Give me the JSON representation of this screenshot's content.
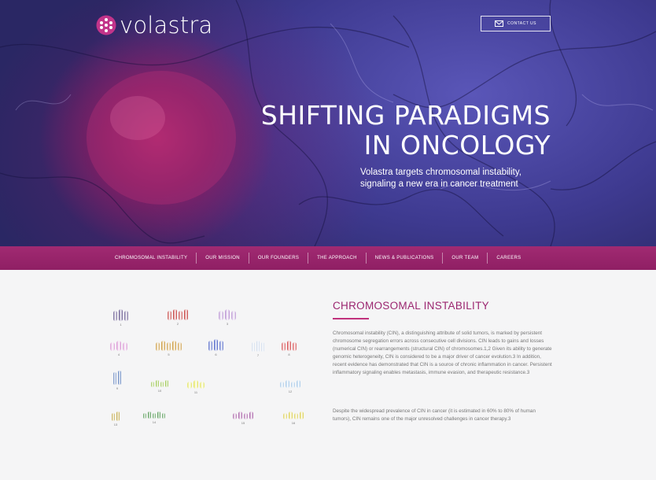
{
  "brand": {
    "name": "volastra",
    "colors": {
      "magenta": "#9b2670",
      "nav": "#9a2570",
      "hero_blue": "#4a46a0"
    }
  },
  "header": {
    "contact_label": "CONTACT US",
    "contact_icon": "mail-icon"
  },
  "hero": {
    "headline_line1": "SHIFTING PARADIGMS",
    "headline_line2": "IN ONCOLOGY",
    "subhead": "Volastra targets chromosomal instability, signaling a new era in cancer treatment"
  },
  "nav": {
    "items": [
      {
        "label": "CHROMOSOMAL INSTABILITY"
      },
      {
        "label": "OUR MISSION"
      },
      {
        "label": "OUR FOUNDERS"
      },
      {
        "label": "THE APPROACH"
      },
      {
        "label": "NEWS & PUBLICATIONS"
      },
      {
        "label": "OUR TEAM"
      },
      {
        "label": "CAREERS"
      }
    ]
  },
  "section": {
    "title": "CHROMOSOMAL INSTABILITY",
    "paragraph1": "Chromosomal instability (CIN), a distinguishing attribute of solid tumors, is marked by persistent chromosome segregation errors across consecutive cell divisions. CIN leads to gains and losses (numerical CIN) or rearrangements (structural CIN) of chromosomes.1,2 Given its ability to generate genomic heterogeneity, CIN is considered to be a major driver of cancer evolution.3 In addition, recent evidence has demonstrated that CIN is a source of chronic inflammation in cancer. Persistent inflammatory signaling enables metastasis, immune evasion, and therapeutic resistance.3",
    "paragraph2": "Despite the widespread prevalence of CIN in cancer (it is estimated in 60% to 80% of human tumors), CIN remains one of the major unresolved challenges in cancer therapy.3"
  },
  "karyotype": {
    "pairs": [
      {
        "label": "1",
        "color": "#5b4b86"
      },
      {
        "label": "2",
        "color": "#c0302e"
      },
      {
        "label": "3",
        "color": "#b58bd0"
      },
      {
        "label": "4",
        "color": "#d78fd1"
      },
      {
        "label": "5",
        "color": "#c7902a"
      },
      {
        "label": "6",
        "color": "#3d55c2"
      },
      {
        "label": "7",
        "color": "#c9d7ea"
      },
      {
        "label": "8",
        "color": "#d1383a"
      },
      {
        "label": "9",
        "color": "#5176b8"
      },
      {
        "label": "10",
        "color": "#8fbf3a"
      },
      {
        "label": "11",
        "color": "#e1e34d"
      },
      {
        "label": "12",
        "color": "#9fc4e6"
      },
      {
        "label": "13",
        "color": "#b89b2c"
      },
      {
        "label": "14",
        "color": "#3b8a3b"
      },
      {
        "label": "15",
        "color": "#a0529e"
      },
      {
        "label": "16",
        "color": "#d9cb3f"
      }
    ]
  }
}
